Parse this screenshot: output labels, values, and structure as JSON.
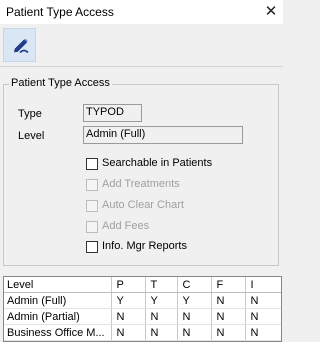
{
  "window": {
    "title": "Patient Type Access",
    "close_glyph": "✕"
  },
  "toolbar": {
    "edit_icon": "pencil-edit-icon"
  },
  "group": {
    "legend": "Patient Type Access",
    "type_label": "Type",
    "type_value": "TYPOD",
    "level_label": "Level",
    "level_value": "Admin (Full)"
  },
  "checkboxes": [
    {
      "label": "Searchable in Patients",
      "checked": false,
      "enabled": true
    },
    {
      "label": "Add Treatments",
      "checked": false,
      "enabled": false
    },
    {
      "label": "Auto Clear Chart",
      "checked": false,
      "enabled": false
    },
    {
      "label": "Add Fees",
      "checked": false,
      "enabled": false
    },
    {
      "label": "Info. Mgr Reports",
      "checked": false,
      "enabled": true
    }
  ],
  "grid": {
    "headers": [
      "Level",
      "P",
      "T",
      "C",
      "F",
      "I"
    ],
    "rows": [
      [
        "Admin (Full)",
        "Y",
        "Y",
        "Y",
        "N",
        "N"
      ],
      [
        "Admin (Partial)",
        "N",
        "N",
        "N",
        "N",
        "N"
      ],
      [
        "Business Office M...",
        "N",
        "N",
        "N",
        "N",
        "N"
      ]
    ]
  }
}
